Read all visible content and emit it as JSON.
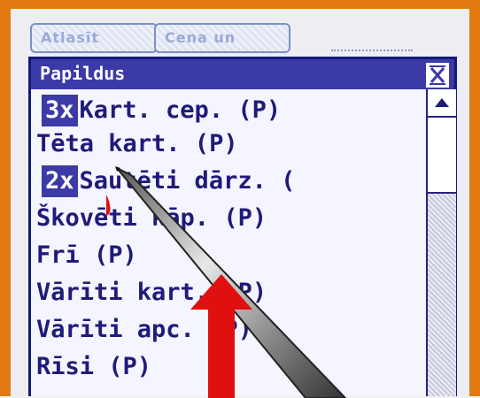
{
  "tabs": [
    {
      "label": "Atlasīt"
    },
    {
      "label": "Cena un"
    }
  ],
  "dialog": {
    "title": "Papildus"
  },
  "items": [
    {
      "qty": "3x",
      "label": "Kart. cep. (P)"
    },
    {
      "qty": "",
      "label": "Tēta kart. (P)"
    },
    {
      "qty": "2x",
      "label": "Sautēti dārz. ("
    },
    {
      "qty": "",
      "label": "Škovēti kāp. (P)"
    },
    {
      "qty": "",
      "label": "Frī (P)"
    },
    {
      "qty": "",
      "label": "Vārīti kart. (P)"
    },
    {
      "qty": "",
      "label": "Vārīti apc. (P)"
    },
    {
      "qty": "",
      "label": "Rīsi (P)"
    }
  ],
  "colors": {
    "frame": "#e07a10",
    "titlebar": "#3b3aa7",
    "text": "#1e1b7a",
    "arrow": "#e01010"
  },
  "icons": {
    "close": "close-x-icon",
    "scroll_up": "triangle-up-icon",
    "stylus": "stylus-pen-icon",
    "arrow": "up-arrow-icon"
  }
}
